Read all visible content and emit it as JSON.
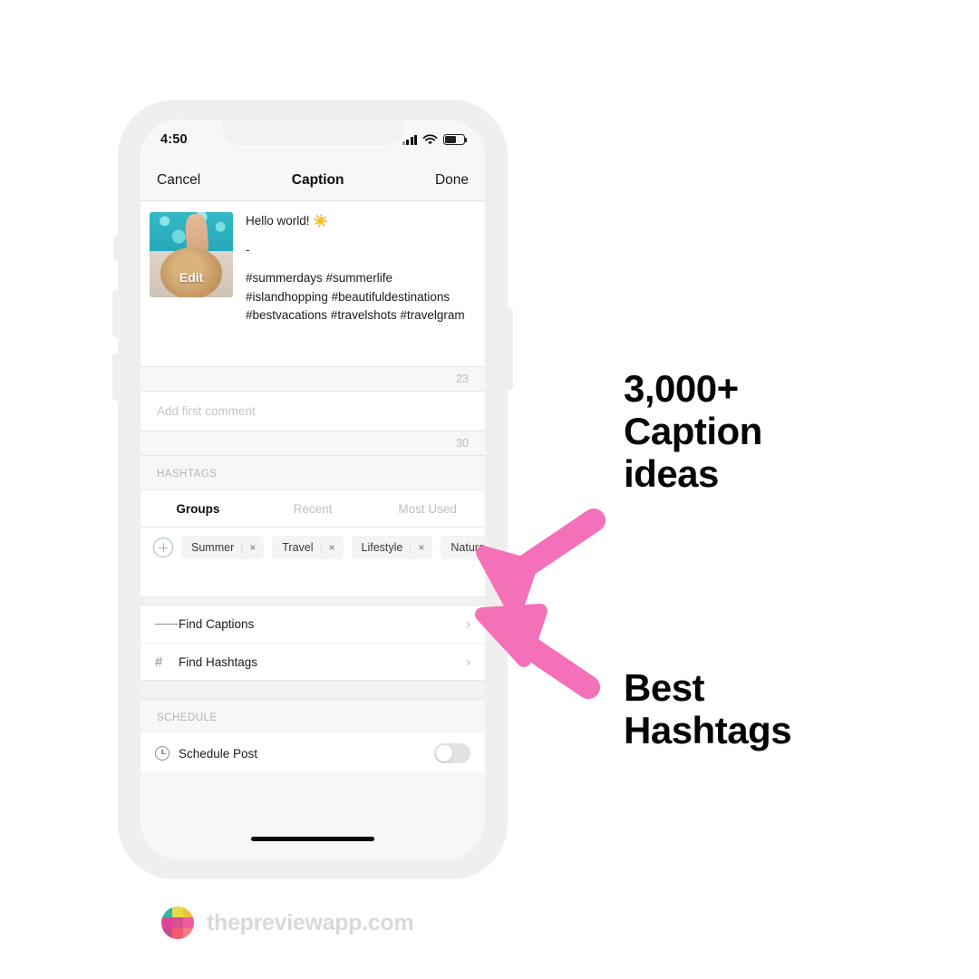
{
  "phone": {
    "status_bar": {
      "time": "4:50",
      "signal_icon": "cellular-signal-icon",
      "wifi_icon": "wifi-icon",
      "battery_icon": "battery-icon"
    },
    "nav": {
      "cancel_label": "Cancel",
      "title": "Caption",
      "done_label": "Done"
    },
    "caption": {
      "thumbnail_edit_label": "Edit",
      "line1": "Hello world! ☀️",
      "line2": "-",
      "line3": " #summerdays #summerlife #islandhopping #beautifuldestinations #bestvacations #travelshots #travelgram",
      "counter": "23"
    },
    "comment": {
      "placeholder": "Add first comment",
      "counter": "30"
    },
    "hashtags_section": {
      "header": "HASHTAGS",
      "tabs": [
        {
          "label": "Groups",
          "active": true
        },
        {
          "label": "Recent",
          "active": false
        },
        {
          "label": "Most Used",
          "active": false
        }
      ],
      "add_group_icon": "plus-circle-icon",
      "chips": [
        {
          "label": "Summer",
          "remove": "×"
        },
        {
          "label": "Travel",
          "remove": "×"
        },
        {
          "label": "Lifestyle",
          "remove": "×"
        },
        {
          "label": "Nature",
          "remove": ""
        }
      ]
    },
    "actions": [
      {
        "label": "Find Captions",
        "icon": "list-lines-icon",
        "chevron": "›"
      },
      {
        "label": "Find Hashtags",
        "icon": "hash-icon",
        "chevron": "›"
      }
    ],
    "schedule": {
      "header": "SCHEDULE",
      "row_label": "Schedule Post",
      "icon": "clock-icon",
      "toggle_state": "off"
    }
  },
  "promo": {
    "headline_one": [
      "3,000+",
      "Caption",
      "ideas"
    ],
    "headline_two": [
      "Best",
      "Hashtags"
    ],
    "arrow_color": "#F470B8",
    "arrows": [
      "arrow-pointing-to-find-captions",
      "arrow-pointing-to-find-hashtags"
    ]
  },
  "footer": {
    "brand": "thepreviewapp.com",
    "logo_icon": "preview-app-logo-icon",
    "logo_colors": [
      "#2fb8a8",
      "#e8d84a",
      "#f0c23c",
      "#e0449a",
      "#d94f8e",
      "#ef5aa0",
      "#c94a8e",
      "#ef5c6e",
      "#f2807a"
    ]
  }
}
